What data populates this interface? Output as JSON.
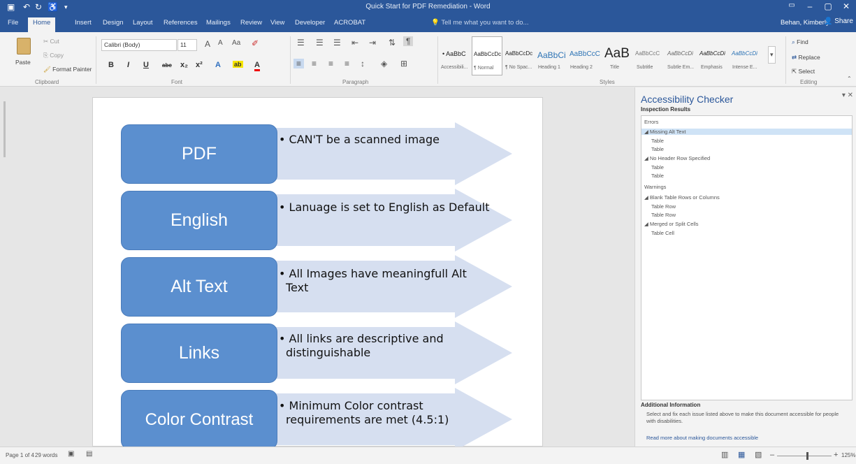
{
  "titlebar": {
    "title": "Quick Start for PDF Remediation - Word"
  },
  "tabs": [
    {
      "label": "File"
    },
    {
      "label": "Home"
    },
    {
      "label": "Insert"
    },
    {
      "label": "Design"
    },
    {
      "label": "Layout"
    },
    {
      "label": "References"
    },
    {
      "label": "Mailings"
    },
    {
      "label": "Review"
    },
    {
      "label": "View"
    },
    {
      "label": "Developer"
    },
    {
      "label": "ACROBAT"
    }
  ],
  "tell_me": "Tell me what you want to do...",
  "user": {
    "name": "Behan, Kimberly",
    "share_label": "Share"
  },
  "ribbon": {
    "clipboard": {
      "paste": "Paste",
      "cut": "Cut",
      "copy": "Copy",
      "format_painter": "Format Painter",
      "group": "Clipboard"
    },
    "font": {
      "name": "Calibri (Body)",
      "size": "11",
      "group": "Font"
    },
    "paragraph": {
      "group": "Paragraph"
    },
    "styles": {
      "group": "Styles",
      "items": [
        {
          "preview": "• AaBbC",
          "name": "Accessibili..."
        },
        {
          "preview": "AaBbCcDc",
          "name": "¶ Normal"
        },
        {
          "preview": "AaBbCcDc",
          "name": "¶ No Spac..."
        },
        {
          "preview": "AaBbCi",
          "name": "Heading 1"
        },
        {
          "preview": "AaBbCcC",
          "name": "Heading 2"
        },
        {
          "preview": "AaB",
          "name": "Title"
        },
        {
          "preview": "AaBbCcC",
          "name": "Subtitle"
        },
        {
          "preview": "AaBbCcDi",
          "name": "Subtle Em..."
        },
        {
          "preview": "AaBbCcDi",
          "name": "Emphasis"
        },
        {
          "preview": "AaBbCcDi",
          "name": "Intense E..."
        }
      ]
    },
    "editing": {
      "find": "Find",
      "replace": "Replace",
      "select": "Select",
      "group": "Editing"
    }
  },
  "document": {
    "rows": [
      {
        "label": "PDF",
        "text_lines": [
          "• CAN'T be a scanned image"
        ]
      },
      {
        "label": "English",
        "text_lines": [
          "• Lanuage is set to English as Default"
        ]
      },
      {
        "label": "Alt Text",
        "text_lines": [
          "• All Images have meaningfull Alt",
          "Text"
        ]
      },
      {
        "label": "Links",
        "text_lines": [
          "• All links are descriptive and",
          "distinguishable"
        ]
      },
      {
        "label": "Color Contrast",
        "text_lines": [
          "• Minimum Color contrast",
          "requirements are met (4.5:1)"
        ]
      }
    ]
  },
  "accessibility_pane": {
    "title": "Accessibility Checker",
    "subtitle": "Inspection Results",
    "sections": [
      {
        "label": "Errors",
        "groups": [
          {
            "label": "Missing Alt Text",
            "items": [
              "Table",
              "Table"
            ]
          },
          {
            "label": "No Header Row Specified",
            "items": [
              "Table",
              "Table"
            ]
          }
        ]
      },
      {
        "label": "Warnings",
        "groups": [
          {
            "label": "Blank Table Rows or Columns",
            "items": [
              "Table Row",
              "Table Row"
            ]
          },
          {
            "label": "Merged or Split Cells",
            "items": [
              "Table Cell"
            ]
          }
        ]
      }
    ],
    "additional_heading": "Additional Information",
    "additional_text": "Select and fix each issue listed above to make this document accessible for people with disabilities.",
    "additional_link": "Read more about making documents accessible"
  },
  "statusbar": {
    "page": "Page 1 of 4",
    "words": "29 words",
    "zoom": "125%"
  },
  "colors": {
    "accent": "#2b579a",
    "shape_fill": "#5b8fcf",
    "arrow_fill": "#d6dff0"
  }
}
